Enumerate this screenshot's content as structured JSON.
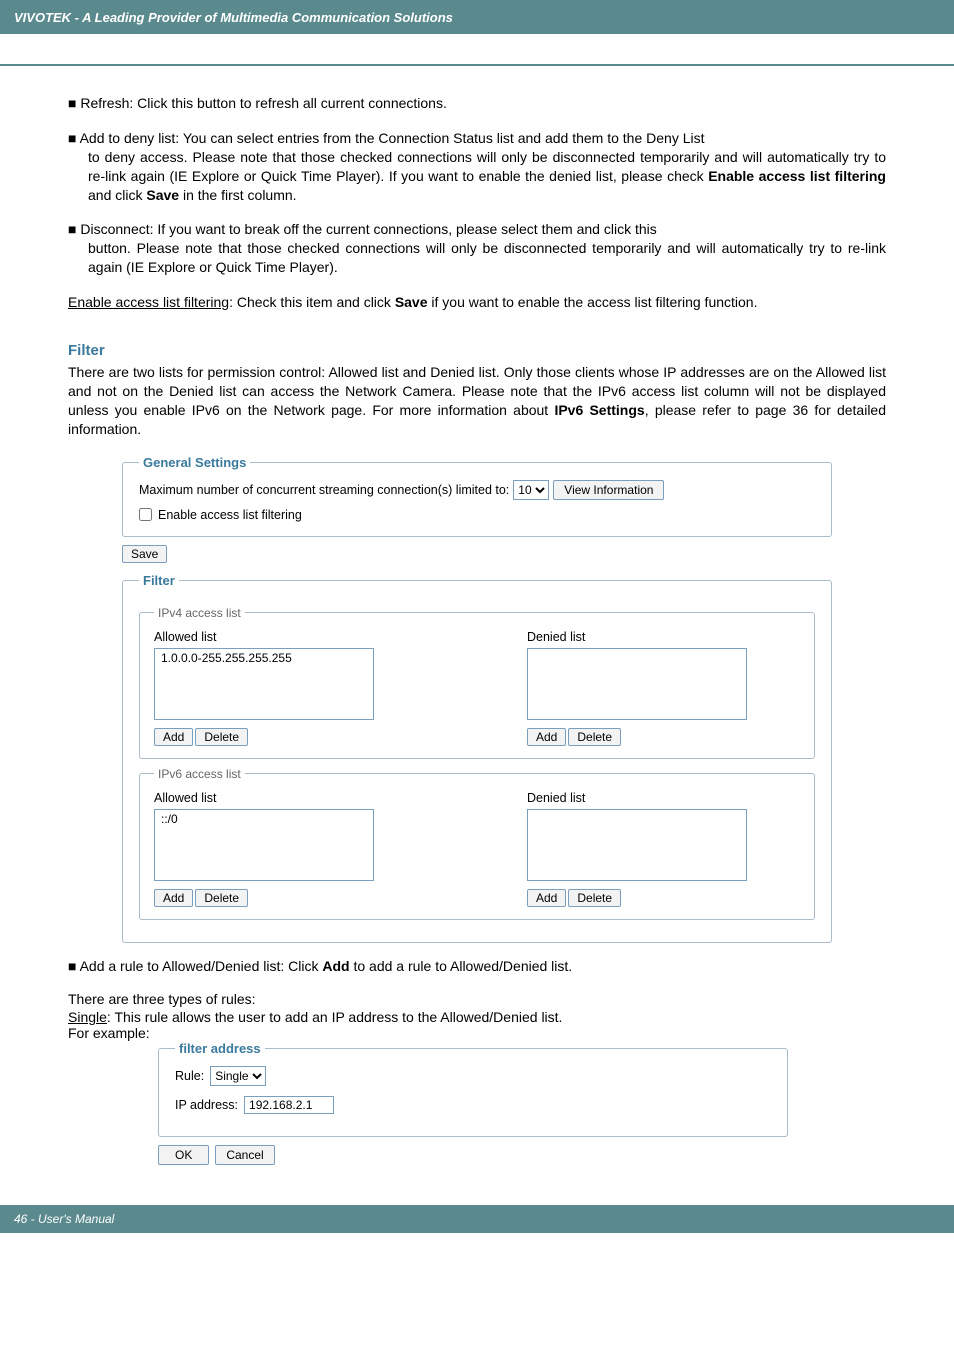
{
  "header": {
    "title": "VIVOTEK - A Leading Provider of Multimedia Communication Solutions"
  },
  "bullets": {
    "refresh": "Refresh: Click this button to refresh all current connections.",
    "addDeny_line1": "Add to deny list: You can select entries from the Connection Status list and add them to the Deny List",
    "addDeny_cont": "to deny access. Please note that those checked connections will only be disconnected temporarily and will automatically try to re-link again (IE Explore or Quick Time Player). If you want to enable the denied list, please check ",
    "addDeny_bold": "Enable access list filtering",
    "addDeny_after_bold": " and click ",
    "addDeny_bold2": "Save",
    "addDeny_tail": " in the first column.",
    "disconnect_line1": "Disconnect: If you want to break off the current connections, please select them and click this",
    "disconnect_cont": "button. Please note that those checked connections will only be disconnected temporarily and will automatically try to re-link again (IE Explore or Quick Time Player)."
  },
  "enableAccess": {
    "underline": "Enable access list filtering",
    "before_bold": ": Check this item and click ",
    "bold": "Save",
    "after_bold": " if you want to enable the access list filtering function."
  },
  "filterSection": {
    "heading": "Filter",
    "para_before_bold": "There are two lists for permission control: Allowed list and Denied list. Only those clients whose IP addresses are on the Allowed list and not on the Denied list can access the Network Camera. Please note that the IPv6 access list column will not be displayed unless you enable IPv6 on the Network page. For more information about ",
    "bold": "IPv6 Settings",
    "after_bold": ", please refer to page 36 for detailed information."
  },
  "generalSettings": {
    "legend": "General Settings",
    "concurrentLabel": "Maximum number of concurrent streaming connection(s) limited to:",
    "concurrentValue": "10",
    "viewInfo": "View Information",
    "enableFiltering": "Enable access list filtering",
    "save": "Save"
  },
  "filterBox": {
    "legend": "Filter",
    "ipv4Legend": "IPv4 access list",
    "ipv6Legend": "IPv6 access list",
    "allowed": "Allowed list",
    "denied": "Denied list",
    "ipv4AllowedItem": "1.0.0.0-255.255.255.255",
    "ipv6AllowedItem": "::/0",
    "add": "Add",
    "delete": "Delete"
  },
  "addRule": {
    "before_bold": "Add a rule to Allowed/Denied list: Click ",
    "bold": "Add",
    "after_bold": " to add a rule to Allowed/Denied list."
  },
  "ruleIntro": {
    "threeTypes": "There are three types of rules:",
    "single_underline": "Single",
    "single_rest": ": This rule allows the user to add an IP address to the Allowed/Denied list.",
    "forExample": "For example:"
  },
  "filterAddress": {
    "legend": "filter address",
    "ruleLabel": "Rule:",
    "ruleValue": "Single",
    "ipLabel": "IP address:",
    "ipValue": "192.168.2.1",
    "ok": "OK",
    "cancel": "Cancel"
  },
  "footer": {
    "text": "46 - User's Manual"
  }
}
